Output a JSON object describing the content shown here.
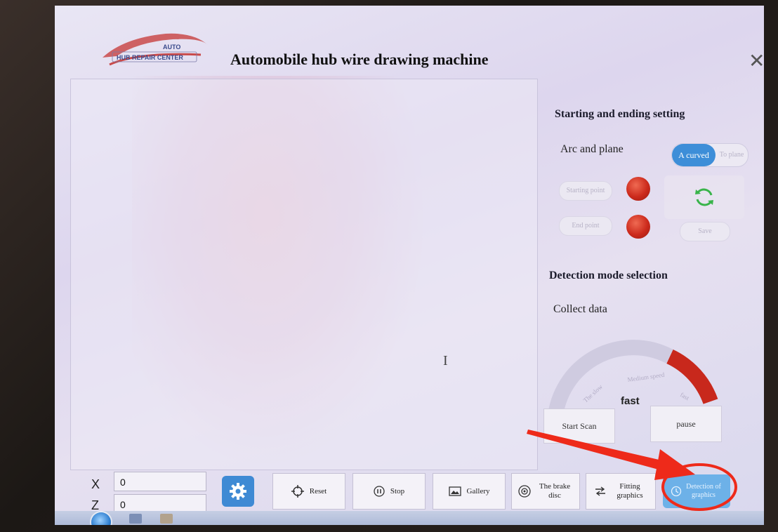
{
  "app": {
    "logo_text_top": "AUTO",
    "logo_text_bottom": "HUB REPAIR CENTER",
    "title": "Automobile hub wire drawing machine"
  },
  "right_panel": {
    "section1_title": "Starting and ending setting",
    "arc_label": "Arc and plane",
    "toggle_on": "A curved",
    "toggle_off": "To plane",
    "start_point_btn": "Starting point",
    "end_point_btn": "End point",
    "save_btn": "Save",
    "section2_title": "Detection mode selection",
    "collect_label": "Collect data",
    "gauge_labels": [
      "The slow",
      "Medium speed",
      "fast"
    ],
    "gauge_value": "fast",
    "start_scan": "Start Scan",
    "pause": "pause"
  },
  "coords": {
    "x_label": "X",
    "x_value": "0",
    "z_label": "Z",
    "z_value": "0"
  },
  "toolbar": {
    "reset": "Reset",
    "stop": "Stop",
    "gallery": "Gallery",
    "brake_disc": "The brake disc",
    "fitting": "Fitting graphics",
    "detection": "Detection of graphics"
  },
  "colors": {
    "accent": "#3f8ad4",
    "led_red": "#cc2a1c",
    "gauge_red": "#c8281c",
    "annotation_red": "#ee2a1a"
  }
}
